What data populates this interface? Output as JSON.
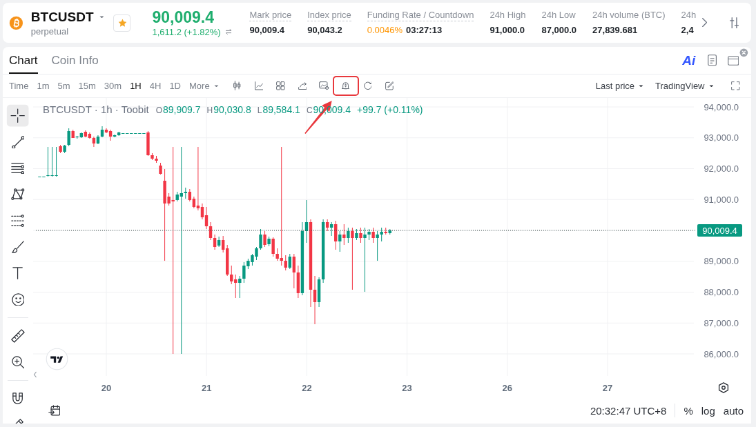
{
  "ticker": {
    "symbol": "BTCUSDT",
    "subtitle": "perpetual",
    "favorite": true,
    "price": "90,009.4",
    "change": "1,611.2 (+1.82%)",
    "rising": true,
    "stats": [
      {
        "label": "Mark price",
        "underlined": true,
        "values": [
          {
            "text": "90,009.4",
            "highlight": false
          }
        ]
      },
      {
        "label": "Index price",
        "underlined": true,
        "values": [
          {
            "text": "90,043.2",
            "highlight": false
          }
        ]
      },
      {
        "label": "Funding Rate / Countdown",
        "underlined": true,
        "values": [
          {
            "text": "0.0046%",
            "highlight": true
          },
          {
            "text": "03:27:13",
            "highlight": false
          }
        ]
      },
      {
        "label": "24h High",
        "underlined": false,
        "values": [
          {
            "text": "91,000.0",
            "highlight": false
          }
        ]
      },
      {
        "label": "24h Low",
        "underlined": false,
        "values": [
          {
            "text": "87,000.0",
            "highlight": false
          }
        ]
      },
      {
        "label": "24h volume (BTC)",
        "underlined": false,
        "values": [
          {
            "text": "27,839.681",
            "highlight": false
          }
        ]
      },
      {
        "label": "24h",
        "underlined": false,
        "values": [
          {
            "text": "2,4",
            "highlight": false
          }
        ]
      }
    ]
  },
  "tabs": [
    {
      "label": "Chart",
      "selected": true
    },
    {
      "label": "Coin Info",
      "selected": false
    }
  ],
  "panel_actions": {
    "assistant": "Ai"
  },
  "toolbar": {
    "intervals": [
      {
        "label": "Time",
        "selected": false
      },
      {
        "label": "1m",
        "selected": false
      },
      {
        "label": "5m",
        "selected": false
      },
      {
        "label": "15m",
        "selected": false
      },
      {
        "label": "30m",
        "selected": false
      },
      {
        "label": "1H",
        "selected": true
      },
      {
        "label": "4H",
        "selected": false
      },
      {
        "label": "1D",
        "selected": false
      }
    ],
    "more": "More",
    "tools": [
      {
        "kind": "candles",
        "highlighted": false
      },
      {
        "kind": "line_chart",
        "highlighted": false
      },
      {
        "kind": "grid",
        "highlighted": false
      },
      {
        "kind": "share",
        "highlighted": false
      },
      {
        "kind": "image",
        "highlighted": false
      },
      {
        "kind": "bell",
        "highlighted": true
      },
      {
        "kind": "refresh",
        "highlighted": false
      },
      {
        "kind": "edit",
        "highlighted": false
      }
    ],
    "price_source": "Last price",
    "chart_engine": "TradingView"
  },
  "drawing_tool_groups": [
    [
      {
        "kind": "crosshair",
        "selected": true
      },
      {
        "kind": "trend_line",
        "selected": false
      },
      {
        "kind": "hlines",
        "selected": false
      },
      {
        "kind": "zigzag",
        "selected": false
      },
      {
        "kind": "dotted_lines",
        "selected": false
      },
      {
        "kind": "brush",
        "selected": false
      },
      {
        "kind": "text",
        "selected": false
      },
      {
        "kind": "smiley",
        "selected": false
      }
    ],
    [
      {
        "kind": "ruler",
        "selected": false
      },
      {
        "kind": "zoom_in",
        "selected": false
      }
    ],
    [
      {
        "kind": "magnet",
        "selected": false
      },
      {
        "kind": "pencil",
        "selected": false
      }
    ]
  ],
  "legend": {
    "title": "BTCUSDT · 1h · Toobit",
    "rising": true,
    "ohlc": [
      {
        "key": "O",
        "value": "89,909.7"
      },
      {
        "key": "H",
        "value": "90,030.8"
      },
      {
        "key": "L",
        "value": "89,584.1"
      },
      {
        "key": "C",
        "value": "90,009.4"
      }
    ],
    "change": "+99.7 (+0.11%)"
  },
  "chart": {
    "y_axis_labels": [
      "94,000.0",
      "93,000.0",
      "92,000.0",
      "91,000.0",
      "89,000.0",
      "88,000.0",
      "87,000.0",
      "86,000.0"
    ],
    "x_axis_labels": [
      "20",
      "21",
      "22",
      "23",
      "26",
      "27"
    ],
    "last_price": "90,009.4"
  },
  "status_bar": {
    "time": "20:32:47 UTC+8",
    "scale_options": [
      "%",
      "log",
      "auto"
    ]
  }
}
